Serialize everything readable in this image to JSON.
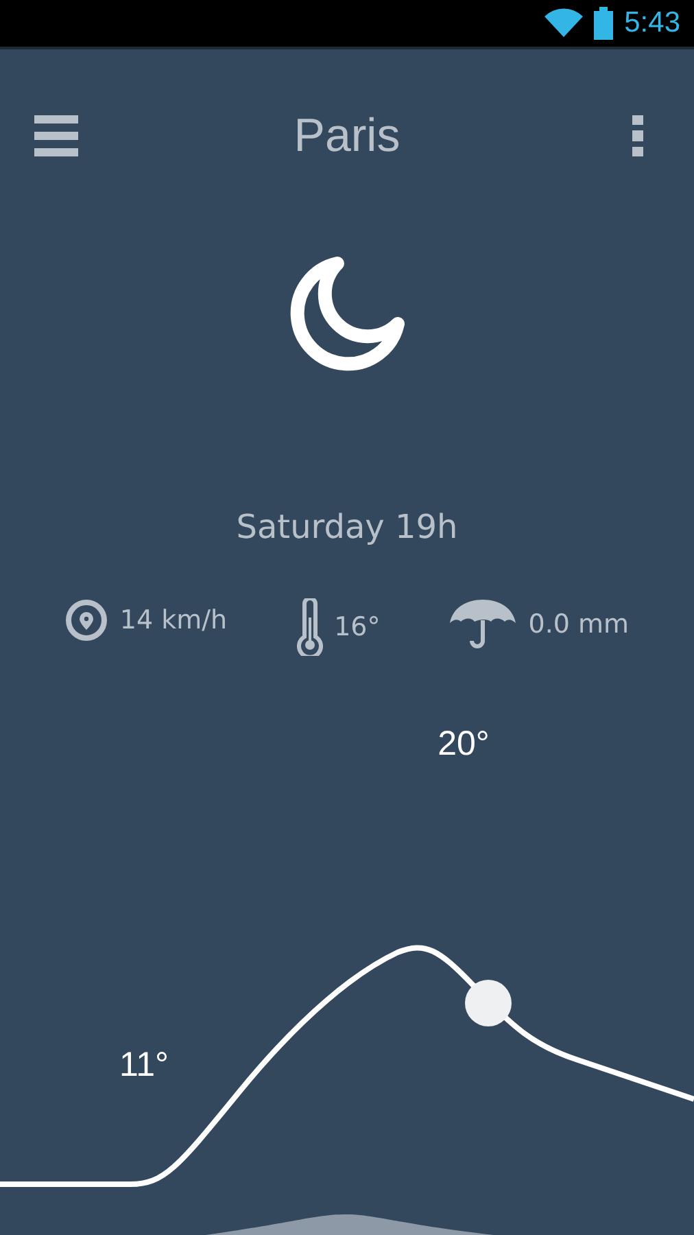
{
  "status_bar": {
    "time": "5:43"
  },
  "toolbar": {
    "title": "Paris"
  },
  "forecast": {
    "day_time": "Saturday 19h"
  },
  "details": [
    {
      "kind": "wind",
      "value": "14 km/h"
    },
    {
      "kind": "temperature",
      "value": "16°"
    },
    {
      "kind": "rain",
      "value": "0.0 mm"
    }
  ],
  "graph": {
    "high_label": "20°",
    "low_label": "11°"
  }
}
